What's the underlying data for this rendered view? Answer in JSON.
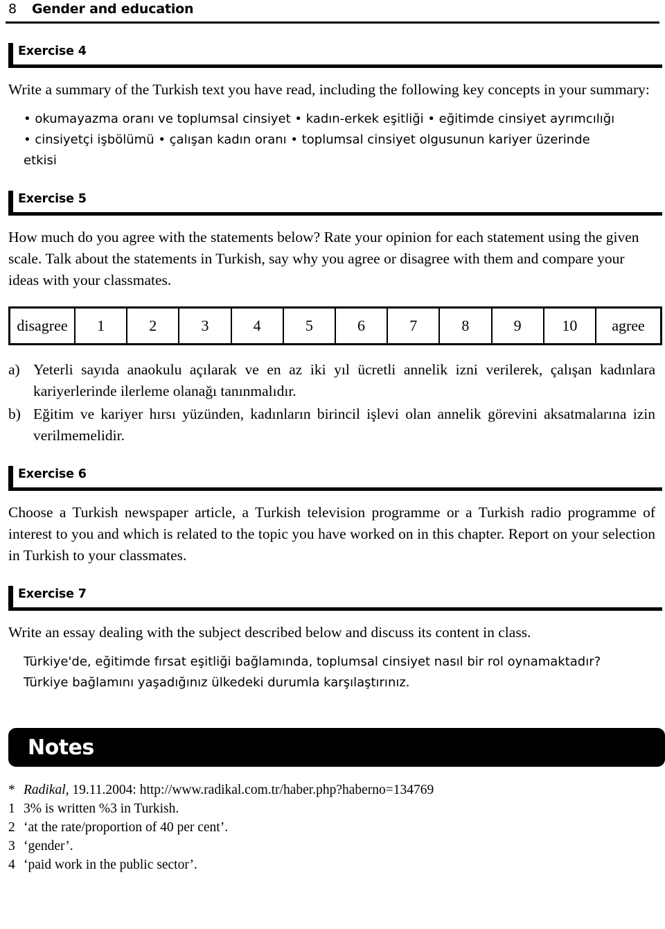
{
  "running_head": {
    "page_number": "8",
    "title": "Gender and education"
  },
  "exercises": [
    {
      "heading": "Exercise 4",
      "english_paragraphs": [
        "Write a summary of the Turkish text you have read, including the following key concepts in your summary:"
      ],
      "turkish_paragraphs": [
        "• okumayazma oranı ve toplumsal cinsiyet • kadın-erkek eşitliği • eğitimde cinsiyet ayrımcılığı • cinsiyetçi işbölümü • çalışan kadın oranı • toplumsal cinsiyet olgusunun kariyer üzerinde etkisi"
      ]
    },
    {
      "heading": "Exercise 5",
      "english_paragraphs": [
        "How much do you agree with the statements below? Rate your opinion for each statement using the given scale. Talk about the statements in Turkish, say why you agree or disagree with them and compare your ideas with your classmates."
      ],
      "statements": [
        {
          "marker": "a)",
          "text": "Yeterli sayıda anaokulu açılarak ve en az iki yıl ücretli annelik izni verilerek, çalışan kadınlara kariyerlerinde ilerleme olanağı tanınmalıdır."
        },
        {
          "marker": "b)",
          "text": "Eğitim ve kariyer hırsı yüzünden, kadınların birincil işlevi olan annelik görevini aksatmalarına izin verilmemelidir."
        }
      ]
    },
    {
      "heading": "Exercise 6",
      "english_paragraphs": [
        "Choose a Turkish newspaper article, a Turkish television programme or a Turkish radio programme of interest to you and which is related to the topic you have worked on in this chapter. Report on your selection in Turkish to your classmates."
      ]
    },
    {
      "heading": "Exercise 7",
      "english_paragraphs": [
        "Write an essay dealing with the subject described below and discuss its content in class."
      ],
      "turkish_paragraphs": [
        "Türkiye'de, eğitimde fırsat eşitliği bağlamında, toplumsal cinsiyet nasıl bir rol oynamaktadır? Türkiye bağlamını yaşadığınız ülkedeki durumla karşılaştırınız."
      ]
    }
  ],
  "scale": {
    "left_label": "disagree",
    "right_label": "agree",
    "values": [
      "1",
      "2",
      "3",
      "4",
      "5",
      "6",
      "7",
      "8",
      "9",
      "10"
    ]
  },
  "notes": {
    "banner_title": "Notes",
    "banner_color": "#000000",
    "banner_text_color": "#ffffff",
    "items": [
      {
        "mark": "*",
        "source_title": "Radikal,",
        "text": " 19.11.2004: http://www.radikal.com.tr/haber.php?haberno=134769"
      },
      {
        "mark": "1",
        "source_title": "",
        "text": "3% is written %3 in Turkish."
      },
      {
        "mark": "2",
        "source_title": "",
        "text": "‘at the rate/proportion of 40 per cent’."
      },
      {
        "mark": "3",
        "source_title": "",
        "text": "‘gender’."
      },
      {
        "mark": "4",
        "source_title": "",
        "text": "‘paid work in the public sector’."
      }
    ]
  }
}
